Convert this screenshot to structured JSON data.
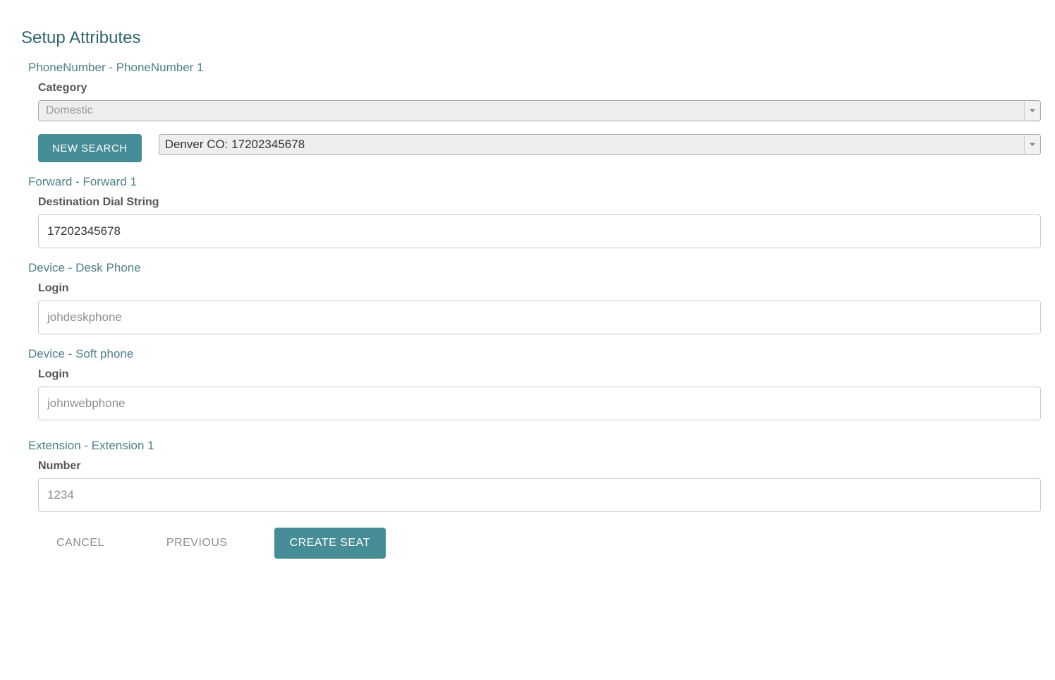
{
  "page": {
    "title": "Setup Attributes"
  },
  "phoneNumber": {
    "header": "PhoneNumber - PhoneNumber 1",
    "categoryLabel": "Category",
    "categoryValue": "Domestic",
    "newSearchLabel": "New Search",
    "selectedNumber": "Denver CO: 17202345678"
  },
  "forward": {
    "header": "Forward - Forward 1",
    "destLabel": "Destination Dial String",
    "destValue": "17202345678"
  },
  "deviceDesk": {
    "header": "Device - Desk Phone",
    "loginLabel": "Login",
    "loginPlaceholder": "johdeskphone"
  },
  "deviceSoft": {
    "header": "Device - Soft phone",
    "loginLabel": "Login",
    "loginPlaceholder": "johnwebphone"
  },
  "extension": {
    "header": "Extension - Extension 1",
    "numberLabel": "Number",
    "numberPlaceholder": "1234"
  },
  "actions": {
    "cancel": "Cancel",
    "previous": "Previous",
    "createSeat": "Create Seat"
  }
}
